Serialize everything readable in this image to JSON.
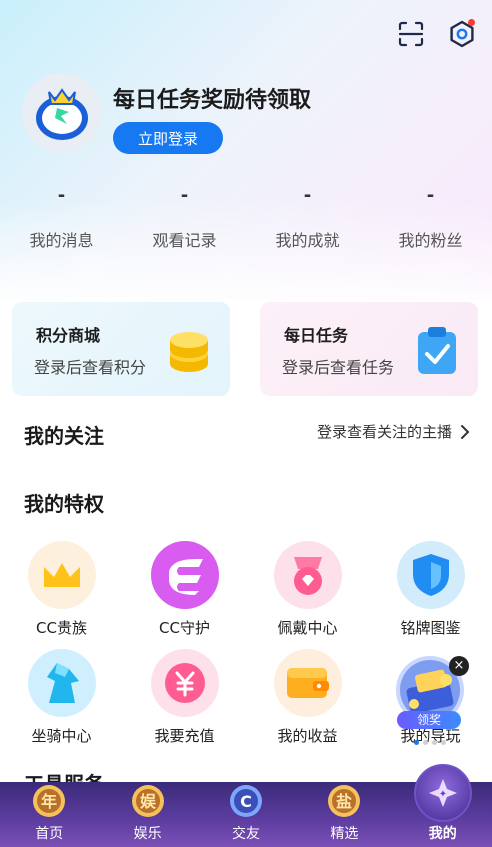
{
  "header": {
    "scan_icon": "scan-icon",
    "settings_icon": "settings-icon",
    "headline": "每日任务奖励待领取",
    "login_button": "立即登录"
  },
  "stats": [
    {
      "value": "-",
      "label": "我的消息"
    },
    {
      "value": "-",
      "label": "观看记录"
    },
    {
      "value": "-",
      "label": "我的成就"
    },
    {
      "value": "-",
      "label": "我的粉丝"
    }
  ],
  "cards": {
    "points": {
      "title": "积分商城",
      "subtitle": "登录后查看积分"
    },
    "task": {
      "title": "每日任务",
      "subtitle": "登录后查看任务"
    }
  },
  "follow": {
    "title": "我的关注",
    "link": "登录查看关注的主播"
  },
  "privileges": {
    "title": "我的特权",
    "items": [
      {
        "label": "CC贵族",
        "icon": "crown-icon"
      },
      {
        "label": "CC守护",
        "icon": "guard-icon"
      },
      {
        "label": "佩戴中心",
        "icon": "medal-icon"
      },
      {
        "label": "铭牌图鉴",
        "icon": "shield-icon"
      },
      {
        "label": "坐骑中心",
        "icon": "horse-icon"
      },
      {
        "label": "我要充值",
        "icon": "yen-icon"
      },
      {
        "label": "我的收益",
        "icon": "wallet-icon"
      },
      {
        "label": "我的导玩",
        "icon": "gift-icon"
      }
    ]
  },
  "float_ad": {
    "badge": "领奖",
    "close": "×"
  },
  "tools": {
    "title": "工具服务"
  },
  "tabbar": [
    {
      "label": "首页",
      "glyph": "年"
    },
    {
      "label": "娱乐",
      "glyph": "娱"
    },
    {
      "label": "交友",
      "glyph": "C"
    },
    {
      "label": "精选",
      "glyph": "盐"
    },
    {
      "label": "我的",
      "glyph": "✦"
    }
  ],
  "colors": {
    "accent": "#1679f2",
    "tabbar": "#4a3390"
  }
}
